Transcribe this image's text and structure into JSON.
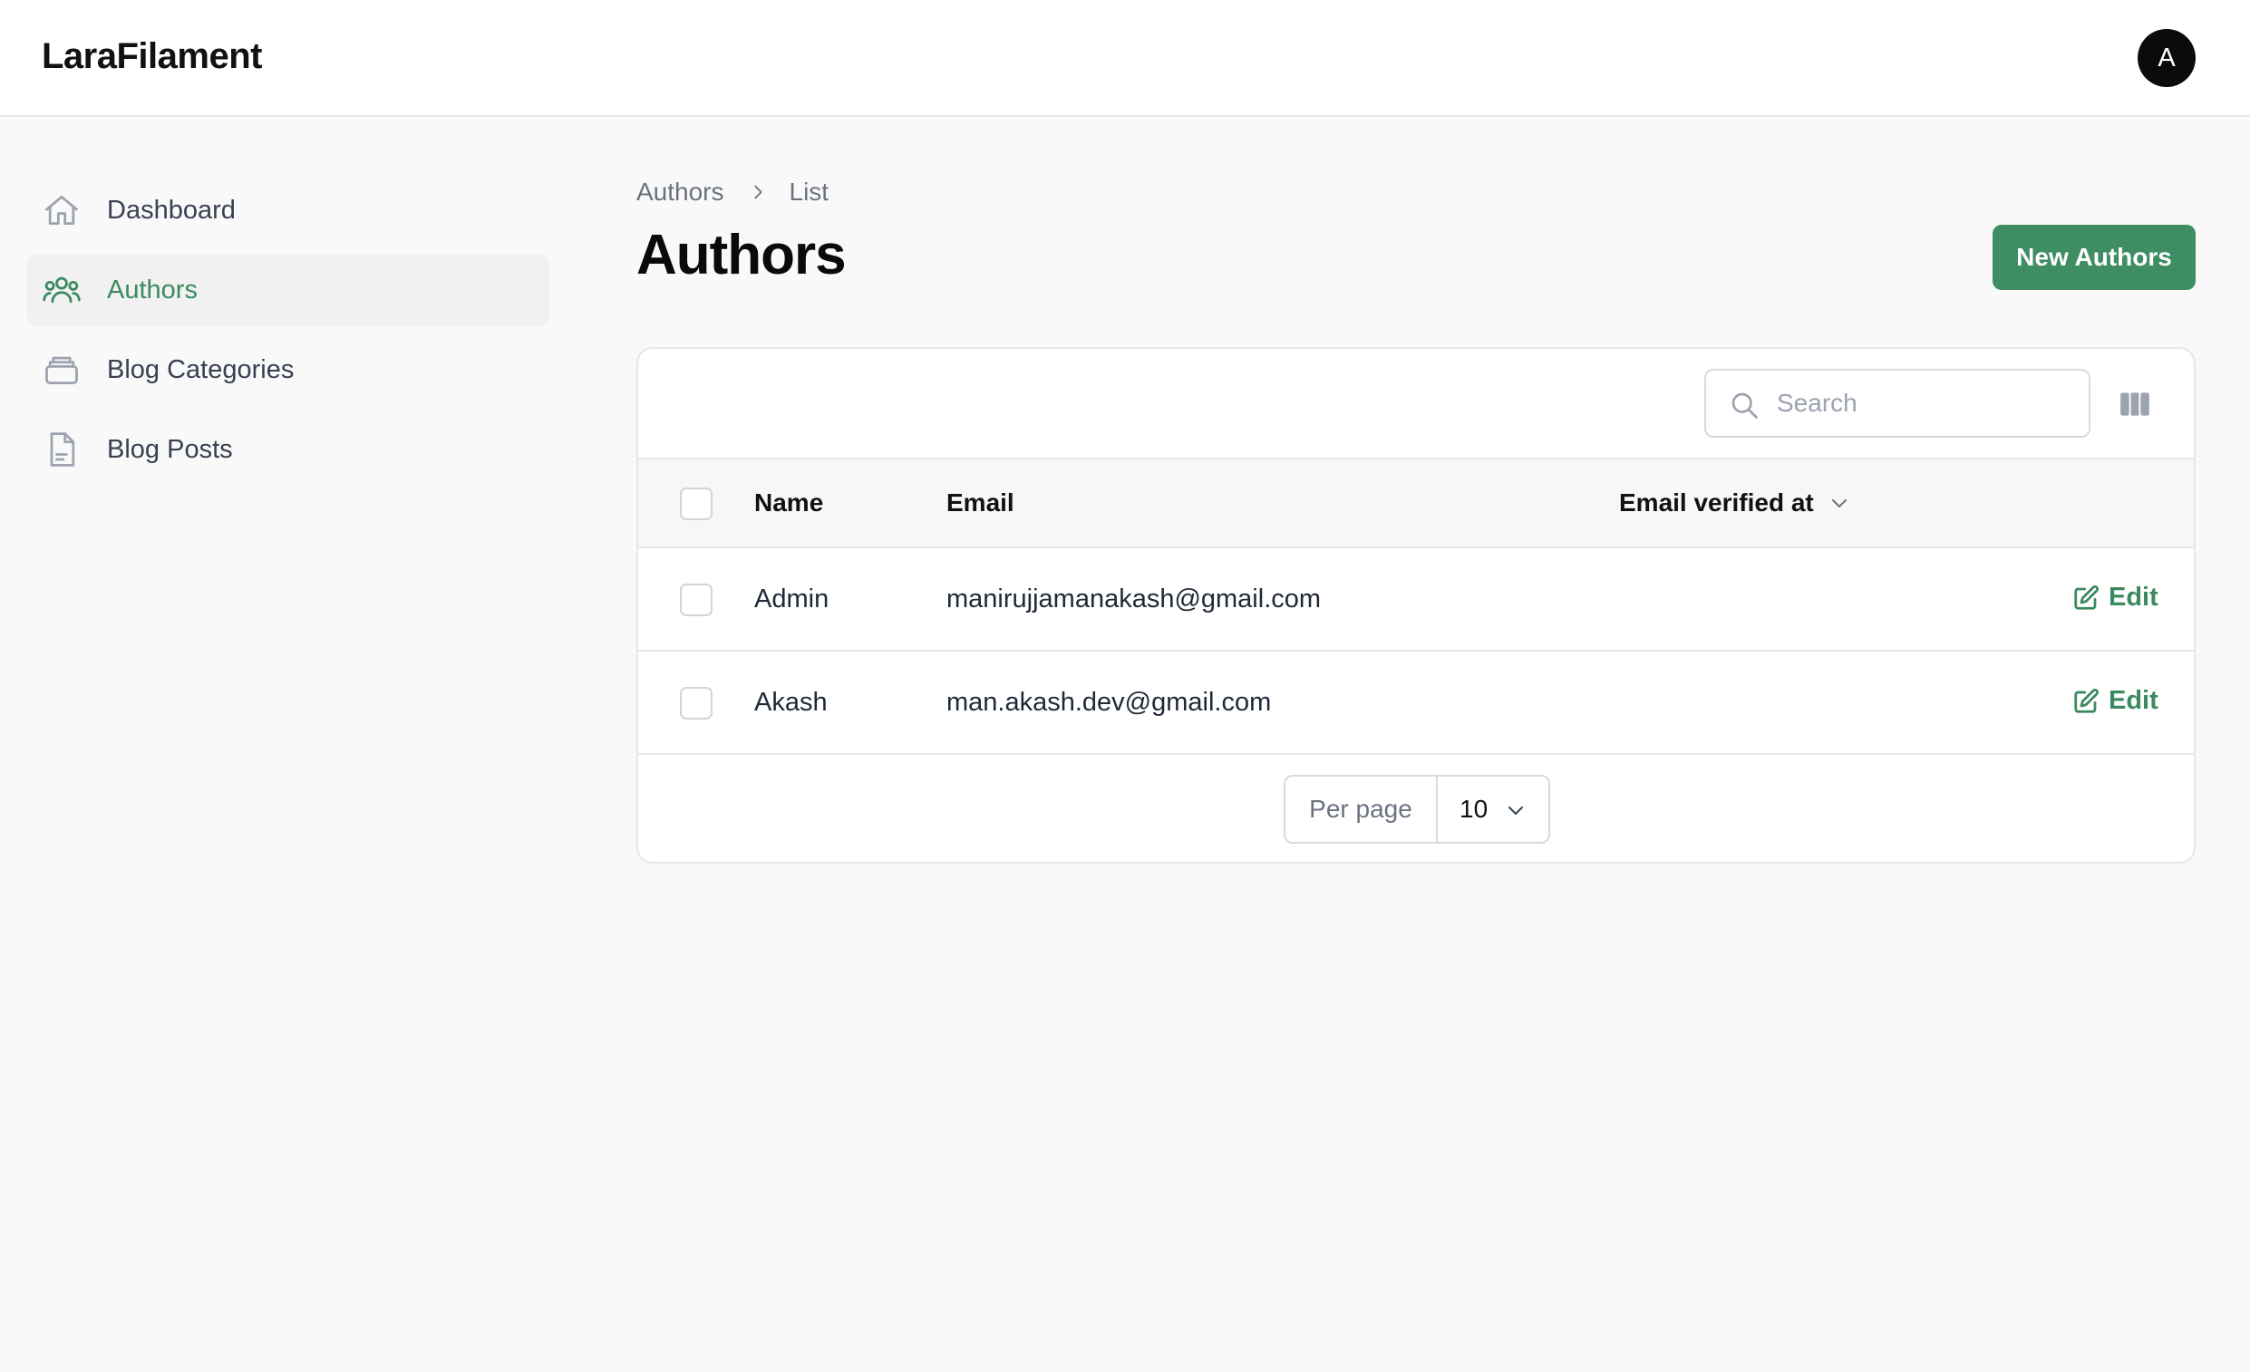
{
  "app": {
    "brand": "LaraFilament",
    "user_initial": "A"
  },
  "sidebar": {
    "items": [
      {
        "label": "Dashboard",
        "icon": "home-icon",
        "active": false
      },
      {
        "label": "Authors",
        "icon": "users-group-icon",
        "active": true
      },
      {
        "label": "Blog Categories",
        "icon": "stack-icon",
        "active": false
      },
      {
        "label": "Blog Posts",
        "icon": "document-icon",
        "active": false
      }
    ]
  },
  "breadcrumb": {
    "items": [
      "Authors",
      "List"
    ]
  },
  "page": {
    "title": "Authors",
    "new_button_label": "New Authors"
  },
  "table": {
    "search_placeholder": "Search",
    "columns": {
      "name": "Name",
      "email": "Email",
      "email_verified_at": "Email verified at"
    },
    "rows": [
      {
        "name": "Admin",
        "email": "manirujjamanakash@gmail.com",
        "email_verified_at": "",
        "action": "Edit"
      },
      {
        "name": "Akash",
        "email": "man.akash.dev@gmail.com",
        "email_verified_at": "",
        "action": "Edit"
      }
    ],
    "pagination": {
      "per_page_label": "Per page",
      "per_page_value": "10"
    }
  },
  "colors": {
    "primary": "#3e8d63",
    "active_text": "#3b8a5f",
    "background": "#f9f9f9"
  }
}
